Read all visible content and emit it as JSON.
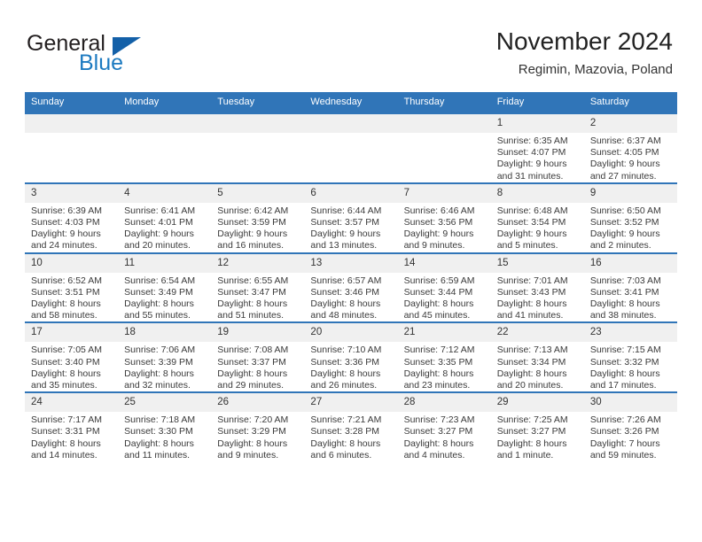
{
  "logo": {
    "word1": "General",
    "word2": "Blue",
    "flag_icon": "triangle-flag-icon",
    "brand_blue": "#1c7ac0",
    "flag_blue": "#1360a8"
  },
  "header": {
    "title": "November 2024",
    "subtitle": "Regimin, Mazovia, Poland"
  },
  "theme": {
    "header_bar": "#3075b8",
    "daynum_band": "#f0f0f0",
    "text": "#333333"
  },
  "weekday_headers": [
    "Sunday",
    "Monday",
    "Tuesday",
    "Wednesday",
    "Thursday",
    "Friday",
    "Saturday"
  ],
  "weeks": [
    [
      {
        "day": "",
        "empty": true,
        "sunrise": "",
        "sunset": "",
        "daylight1": "",
        "daylight2": ""
      },
      {
        "day": "",
        "empty": true,
        "sunrise": "",
        "sunset": "",
        "daylight1": "",
        "daylight2": ""
      },
      {
        "day": "",
        "empty": true,
        "sunrise": "",
        "sunset": "",
        "daylight1": "",
        "daylight2": ""
      },
      {
        "day": "",
        "empty": true,
        "sunrise": "",
        "sunset": "",
        "daylight1": "",
        "daylight2": ""
      },
      {
        "day": "",
        "empty": true,
        "sunrise": "",
        "sunset": "",
        "daylight1": "",
        "daylight2": ""
      },
      {
        "day": "1",
        "empty": false,
        "sunrise": "Sunrise: 6:35 AM",
        "sunset": "Sunset: 4:07 PM",
        "daylight1": "Daylight: 9 hours",
        "daylight2": "and 31 minutes."
      },
      {
        "day": "2",
        "empty": false,
        "sunrise": "Sunrise: 6:37 AM",
        "sunset": "Sunset: 4:05 PM",
        "daylight1": "Daylight: 9 hours",
        "daylight2": "and 27 minutes."
      }
    ],
    [
      {
        "day": "3",
        "empty": false,
        "sunrise": "Sunrise: 6:39 AM",
        "sunset": "Sunset: 4:03 PM",
        "daylight1": "Daylight: 9 hours",
        "daylight2": "and 24 minutes."
      },
      {
        "day": "4",
        "empty": false,
        "sunrise": "Sunrise: 6:41 AM",
        "sunset": "Sunset: 4:01 PM",
        "daylight1": "Daylight: 9 hours",
        "daylight2": "and 20 minutes."
      },
      {
        "day": "5",
        "empty": false,
        "sunrise": "Sunrise: 6:42 AM",
        "sunset": "Sunset: 3:59 PM",
        "daylight1": "Daylight: 9 hours",
        "daylight2": "and 16 minutes."
      },
      {
        "day": "6",
        "empty": false,
        "sunrise": "Sunrise: 6:44 AM",
        "sunset": "Sunset: 3:57 PM",
        "daylight1": "Daylight: 9 hours",
        "daylight2": "and 13 minutes."
      },
      {
        "day": "7",
        "empty": false,
        "sunrise": "Sunrise: 6:46 AM",
        "sunset": "Sunset: 3:56 PM",
        "daylight1": "Daylight: 9 hours",
        "daylight2": "and 9 minutes."
      },
      {
        "day": "8",
        "empty": false,
        "sunrise": "Sunrise: 6:48 AM",
        "sunset": "Sunset: 3:54 PM",
        "daylight1": "Daylight: 9 hours",
        "daylight2": "and 5 minutes."
      },
      {
        "day": "9",
        "empty": false,
        "sunrise": "Sunrise: 6:50 AM",
        "sunset": "Sunset: 3:52 PM",
        "daylight1": "Daylight: 9 hours",
        "daylight2": "and 2 minutes."
      }
    ],
    [
      {
        "day": "10",
        "empty": false,
        "sunrise": "Sunrise: 6:52 AM",
        "sunset": "Sunset: 3:51 PM",
        "daylight1": "Daylight: 8 hours",
        "daylight2": "and 58 minutes."
      },
      {
        "day": "11",
        "empty": false,
        "sunrise": "Sunrise: 6:54 AM",
        "sunset": "Sunset: 3:49 PM",
        "daylight1": "Daylight: 8 hours",
        "daylight2": "and 55 minutes."
      },
      {
        "day": "12",
        "empty": false,
        "sunrise": "Sunrise: 6:55 AM",
        "sunset": "Sunset: 3:47 PM",
        "daylight1": "Daylight: 8 hours",
        "daylight2": "and 51 minutes."
      },
      {
        "day": "13",
        "empty": false,
        "sunrise": "Sunrise: 6:57 AM",
        "sunset": "Sunset: 3:46 PM",
        "daylight1": "Daylight: 8 hours",
        "daylight2": "and 48 minutes."
      },
      {
        "day": "14",
        "empty": false,
        "sunrise": "Sunrise: 6:59 AM",
        "sunset": "Sunset: 3:44 PM",
        "daylight1": "Daylight: 8 hours",
        "daylight2": "and 45 minutes."
      },
      {
        "day": "15",
        "empty": false,
        "sunrise": "Sunrise: 7:01 AM",
        "sunset": "Sunset: 3:43 PM",
        "daylight1": "Daylight: 8 hours",
        "daylight2": "and 41 minutes."
      },
      {
        "day": "16",
        "empty": false,
        "sunrise": "Sunrise: 7:03 AM",
        "sunset": "Sunset: 3:41 PM",
        "daylight1": "Daylight: 8 hours",
        "daylight2": "and 38 minutes."
      }
    ],
    [
      {
        "day": "17",
        "empty": false,
        "sunrise": "Sunrise: 7:05 AM",
        "sunset": "Sunset: 3:40 PM",
        "daylight1": "Daylight: 8 hours",
        "daylight2": "and 35 minutes."
      },
      {
        "day": "18",
        "empty": false,
        "sunrise": "Sunrise: 7:06 AM",
        "sunset": "Sunset: 3:39 PM",
        "daylight1": "Daylight: 8 hours",
        "daylight2": "and 32 minutes."
      },
      {
        "day": "19",
        "empty": false,
        "sunrise": "Sunrise: 7:08 AM",
        "sunset": "Sunset: 3:37 PM",
        "daylight1": "Daylight: 8 hours",
        "daylight2": "and 29 minutes."
      },
      {
        "day": "20",
        "empty": false,
        "sunrise": "Sunrise: 7:10 AM",
        "sunset": "Sunset: 3:36 PM",
        "daylight1": "Daylight: 8 hours",
        "daylight2": "and 26 minutes."
      },
      {
        "day": "21",
        "empty": false,
        "sunrise": "Sunrise: 7:12 AM",
        "sunset": "Sunset: 3:35 PM",
        "daylight1": "Daylight: 8 hours",
        "daylight2": "and 23 minutes."
      },
      {
        "day": "22",
        "empty": false,
        "sunrise": "Sunrise: 7:13 AM",
        "sunset": "Sunset: 3:34 PM",
        "daylight1": "Daylight: 8 hours",
        "daylight2": "and 20 minutes."
      },
      {
        "day": "23",
        "empty": false,
        "sunrise": "Sunrise: 7:15 AM",
        "sunset": "Sunset: 3:32 PM",
        "daylight1": "Daylight: 8 hours",
        "daylight2": "and 17 minutes."
      }
    ],
    [
      {
        "day": "24",
        "empty": false,
        "sunrise": "Sunrise: 7:17 AM",
        "sunset": "Sunset: 3:31 PM",
        "daylight1": "Daylight: 8 hours",
        "daylight2": "and 14 minutes."
      },
      {
        "day": "25",
        "empty": false,
        "sunrise": "Sunrise: 7:18 AM",
        "sunset": "Sunset: 3:30 PM",
        "daylight1": "Daylight: 8 hours",
        "daylight2": "and 11 minutes."
      },
      {
        "day": "26",
        "empty": false,
        "sunrise": "Sunrise: 7:20 AM",
        "sunset": "Sunset: 3:29 PM",
        "daylight1": "Daylight: 8 hours",
        "daylight2": "and 9 minutes."
      },
      {
        "day": "27",
        "empty": false,
        "sunrise": "Sunrise: 7:21 AM",
        "sunset": "Sunset: 3:28 PM",
        "daylight1": "Daylight: 8 hours",
        "daylight2": "and 6 minutes."
      },
      {
        "day": "28",
        "empty": false,
        "sunrise": "Sunrise: 7:23 AM",
        "sunset": "Sunset: 3:27 PM",
        "daylight1": "Daylight: 8 hours",
        "daylight2": "and 4 minutes."
      },
      {
        "day": "29",
        "empty": false,
        "sunrise": "Sunrise: 7:25 AM",
        "sunset": "Sunset: 3:27 PM",
        "daylight1": "Daylight: 8 hours",
        "daylight2": "and 1 minute."
      },
      {
        "day": "30",
        "empty": false,
        "sunrise": "Sunrise: 7:26 AM",
        "sunset": "Sunset: 3:26 PM",
        "daylight1": "Daylight: 7 hours",
        "daylight2": "and 59 minutes."
      }
    ]
  ]
}
